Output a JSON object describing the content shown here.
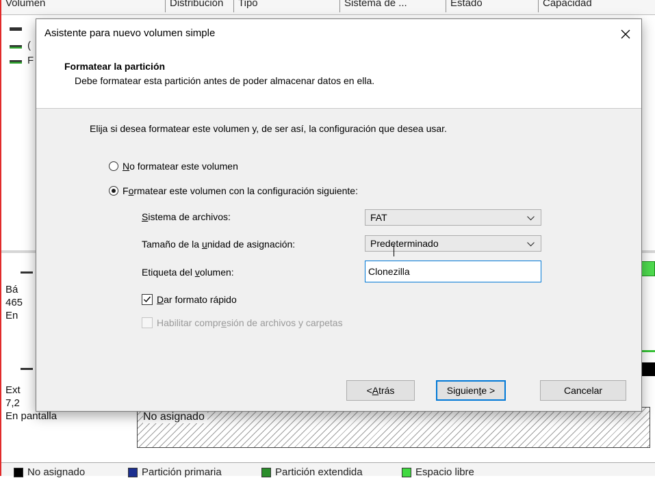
{
  "background": {
    "columns": [
      "Volumen",
      "Distribución",
      "Tipo",
      "Sistema de ...",
      "Estado",
      "Capacidad"
    ],
    "volume_rows": [
      "",
      "(",
      "F"
    ],
    "disk0": {
      "line1": "Bá",
      "line2": "465",
      "line3": "En"
    },
    "disk1": {
      "line1": "Ext",
      "line2": "7,2",
      "status": "En pantalla"
    },
    "unallocated_label": "No asignado",
    "legend": [
      {
        "label": "No asignado",
        "color": "#000000"
      },
      {
        "label": "Partición primaria",
        "color": "#1c2f8f"
      },
      {
        "label": "Partición extendida",
        "color": "#2c8e2c"
      },
      {
        "label": "Espacio libre",
        "color": "#41d941"
      }
    ]
  },
  "dialog": {
    "title": "Asistente para nuevo volumen simple",
    "close_icon": "close-icon",
    "header_title": "Formatear la partición",
    "header_subtitle": "Debe formatear esta partición antes de poder almacenar datos en ella.",
    "intro": "Elija si desea formatear este volumen y, de ser así, la configuración que desea usar.",
    "option_no_format": {
      "mnemonic": "N",
      "rest": "o formatear este volumen",
      "selected": false
    },
    "option_format": {
      "before": "F",
      "mnemonic": "o",
      "rest": "rmatear este volumen con la configuración siguiente:",
      "selected": true
    },
    "file_system": {
      "mnemonic": "S",
      "label_rest": "istema de archivos:",
      "value": "FAT"
    },
    "allocation": {
      "label_before": "Tamaño de la ",
      "mnemonic": "u",
      "label_after": "nidad de asignación:",
      "value": "Predeterminado"
    },
    "volume_label": {
      "label_before": "Etiqueta del ",
      "mnemonic": "v",
      "label_after": "olumen:",
      "value": "Clonezilla"
    },
    "quick_format": {
      "mnemonic": "D",
      "rest": "ar formato rápido",
      "checked": true
    },
    "compression": {
      "before": "Habilitar compr",
      "mnemonic": "e",
      "after": "sión de archivos y carpetas",
      "checked": false,
      "enabled": false
    },
    "buttons": {
      "back": {
        "before": "< ",
        "mnemonic": "A",
        "after": "trás"
      },
      "next": {
        "before": "Siguien",
        "mnemonic": "t",
        "after": "e >"
      },
      "cancel": "Cancelar"
    }
  },
  "colors": {
    "accent": "#0078d7",
    "dialog_bg": "#f0f0f0"
  }
}
